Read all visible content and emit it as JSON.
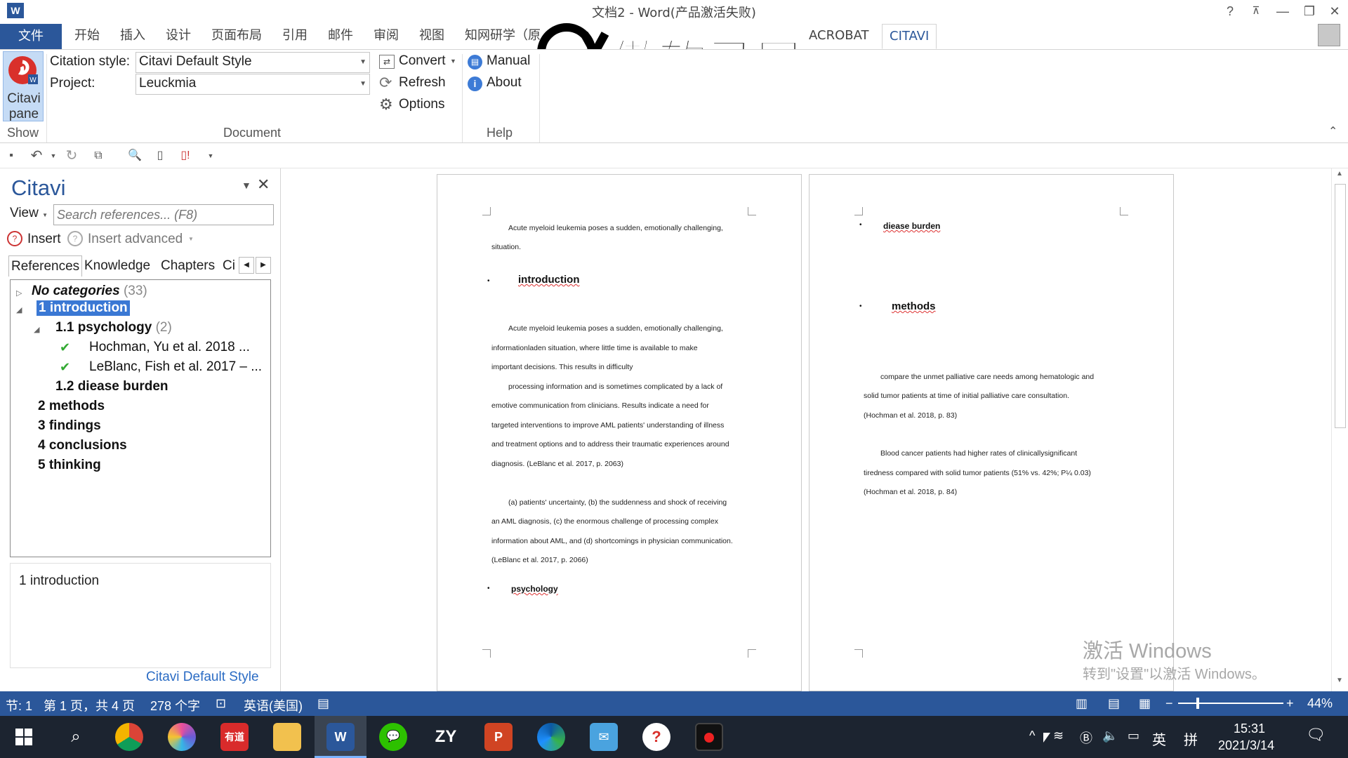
{
  "titlebar": {
    "title": "文档2 - Word(产品激活失败)",
    "help": "?",
    "minimize": "—",
    "restore": "❐",
    "close": "✕"
  },
  "ribbon_tabs": {
    "file": "文件",
    "tabs": [
      "开始",
      "插入",
      "设计",
      "页面布局",
      "引用",
      "邮件",
      "审阅",
      "视图",
      "知网研学（原"
    ],
    "acrobat": "ACROBAT",
    "citavi": "CITAVI"
  },
  "watermark": {
    "text": "傲软录屏"
  },
  "ribbon": {
    "citavi_pane_line1": "Citavi",
    "citavi_pane_line2": "pane",
    "show_label": "Show",
    "citation_style_label": "Citation style:",
    "citation_style_value": "Citavi Default Style",
    "project_label": "Project:",
    "project_value": "Leuckmia",
    "document_label": "Document",
    "convert": "Convert",
    "refresh": "Refresh",
    "options": "Options",
    "manual": "Manual",
    "about": "About",
    "help_label": "Help"
  },
  "pane": {
    "title": "Citavi",
    "view": "View",
    "search_placeholder": "Search references... (F8)",
    "insert": "Insert",
    "insert_advanced": "Insert advanced",
    "tabs": [
      "References",
      "Knowledge",
      "Chapters",
      "Ci"
    ],
    "tree": {
      "no_categories": "No categories",
      "no_categories_count": "(33)",
      "intro": "1 introduction",
      "psychology": "1.1 psychology",
      "psychology_count": "(2)",
      "ref1": "Hochman, Yu et al. 2018 ...",
      "ref2": "LeBlanc, Fish et al. 2017 – ...",
      "diease": "1.2 diease burden",
      "methods": "2 methods",
      "findings": "3 findings",
      "conclusions": "4 conclusions",
      "thinking": "5 thinking"
    },
    "detail": "1 introduction",
    "footer_style": "Citavi Default Style"
  },
  "page1": {
    "p1_line1": "Acute myeloid leukemia poses a sudden, emotionally challenging,",
    "p1_line2": "situation.",
    "h_intro": "introduction",
    "p2_l1": "Acute myeloid leukemia poses a sudden, emotionally challenging,",
    "p2_l2": "informationladen situation, where little time is available to make",
    "p2_l3": "important decisions. This results in difficulty",
    "p3_l1": "processing information and is sometimes complicated by a lack of",
    "p3_l2": "emotive communication from clinicians. Results indicate a need for",
    "p3_l3": "targeted interventions to improve AML patients' understanding of illness",
    "p3_l4": "and treatment options and to address their traumatic experiences around",
    "p3_l5": "diagnosis. (LeBlanc et al. 2017, p. 2063)",
    "p4_l1": "(a) patients' uncertainty, (b) the suddenness and shock of receiving",
    "p4_l2": "an AML diagnosis, (c) the enormous challenge of processing complex",
    "p4_l3": "information about AML, and (d) shortcomings in physician communication.",
    "p4_l4": "(LeBlanc et al. 2017, p. 2066)",
    "h_psych": "psychology"
  },
  "page2": {
    "h_diease": "diease burden",
    "h_methods": "methods",
    "p1_l1": "compare the unmet palliative care needs among hematologic and",
    "p1_l2": "solid tumor patients at time of initial palliative care consultation.",
    "p1_l3": "(Hochman et al. 2018, p. 83)",
    "p2_l1": "Blood cancer patients had higher rates of clinicallysignificant",
    "p2_l2": "tiredness compared with solid tumor patients (51% vs. 42%; P¼ 0.03)",
    "p2_l3": "(Hochman et al. 2018, p. 84)"
  },
  "activation": {
    "line1": "激活 Windows",
    "line2": "转到\"设置\"以激活 Windows。"
  },
  "status": {
    "section": "节: 1",
    "page": "第 1 页，共 4 页",
    "words": "278 个字",
    "lang": "英语(美国)",
    "zoom": "44%"
  },
  "taskbar": {
    "time": "15:31",
    "date": "2021/3/14",
    "ime": "英",
    "ime2": "拼"
  }
}
